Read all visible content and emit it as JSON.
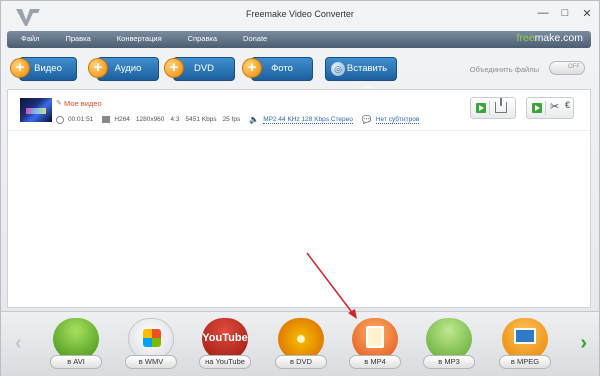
{
  "window": {
    "title": "Freemake Video Converter",
    "controls": {
      "minimize": "—",
      "restore": "□",
      "close": "✕"
    }
  },
  "menu": {
    "items": [
      "Файл",
      "Правка",
      "Конвертация",
      "Справка",
      "Donate"
    ],
    "brand_free": "free",
    "brand_rest": "make.com"
  },
  "toolbar": {
    "buttons": [
      {
        "label": "Видео",
        "icon": "plus-icon"
      },
      {
        "label": "Аудио",
        "icon": "plus-icon"
      },
      {
        "label": "DVD",
        "icon": "plus-icon"
      },
      {
        "label": "Фото",
        "icon": "plus-icon"
      },
      {
        "label": "Вставить URL",
        "icon": "globe-icon"
      }
    ],
    "join_label": "Объединить файлы",
    "join_toggle": "OFF"
  },
  "item": {
    "title": "Мое видео",
    "duration": "00:01:51",
    "codec": "H264",
    "resolution": "1280x960",
    "aspect": "4:3",
    "bitrate": "5451 Kbps",
    "fps": "25 fps",
    "audio": "MP2  44 KHz  128 Kbps  Стерео",
    "subtitles": "Нет субтитров"
  },
  "formats": [
    {
      "label": "в AVI",
      "icon": "avi-icon"
    },
    {
      "label": "в WMV",
      "icon": "wmv-icon"
    },
    {
      "label": "на YouTube",
      "icon": "youtube-icon",
      "icon_text": "YouTube"
    },
    {
      "label": "в DVD",
      "icon": "dvd-icon"
    },
    {
      "label": "в MP4",
      "icon": "mp4-icon"
    },
    {
      "label": "в MP3",
      "icon": "mp3-icon"
    },
    {
      "label": "в MPEG",
      "icon": "mpeg-icon"
    }
  ],
  "colors": {
    "accent_blue": "#1d5f9e",
    "plus_orange": "#f08a00",
    "annotation_red": "#d2232a",
    "brand_green": "#8fd14b"
  }
}
